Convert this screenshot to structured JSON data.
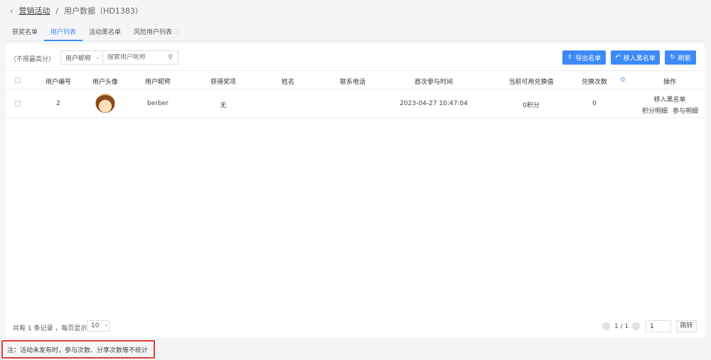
{
  "breadcrumb": {
    "back_icon": "chevron-left-icon",
    "parent": "营销活动",
    "separator": "/",
    "current": "用户数据（HD1383）"
  },
  "tabs": [
    {
      "label": "获奖名单"
    },
    {
      "label": "用户列表",
      "active": true
    },
    {
      "label": "活动黑名单"
    },
    {
      "label": "风险用户列表",
      "info_icon": "question-circle-icon"
    }
  ],
  "toolbar": {
    "filter_label": "（不限最高分）",
    "search_field": "用户昵称",
    "search_placeholder": "搜索用户昵称",
    "export_label": "导出名单",
    "blacklist_label": "移入黑名单",
    "refresh_label": "刷新"
  },
  "table": {
    "columns": [
      "用户编号",
      "用户头像",
      "用户昵称",
      "获得奖项",
      "姓名",
      "联系电话",
      "首次参与时间",
      "当前可用兑换值",
      "兑换次数",
      "操作"
    ],
    "rows": [
      {
        "id": "2",
        "nickname": "berber",
        "prize": "无",
        "name": "",
        "phone": "",
        "first_time": "2023-04-27 10:47:04",
        "balance": "0积分",
        "exchanges": "0",
        "actions": [
          "移入黑名单",
          "积分明细",
          "参与明细"
        ]
      }
    ]
  },
  "pagination": {
    "summary": "共有 1 条记录 ，每页显示",
    "page_size": "10",
    "page_info": "1 / 1",
    "jump_value": "1",
    "jump_label": "跳转"
  },
  "note": "注：活动未发布时，参与次数、分享次数等不统计",
  "colors": {
    "accent": "#3d8af7",
    "note_border": "#e43b3b"
  }
}
